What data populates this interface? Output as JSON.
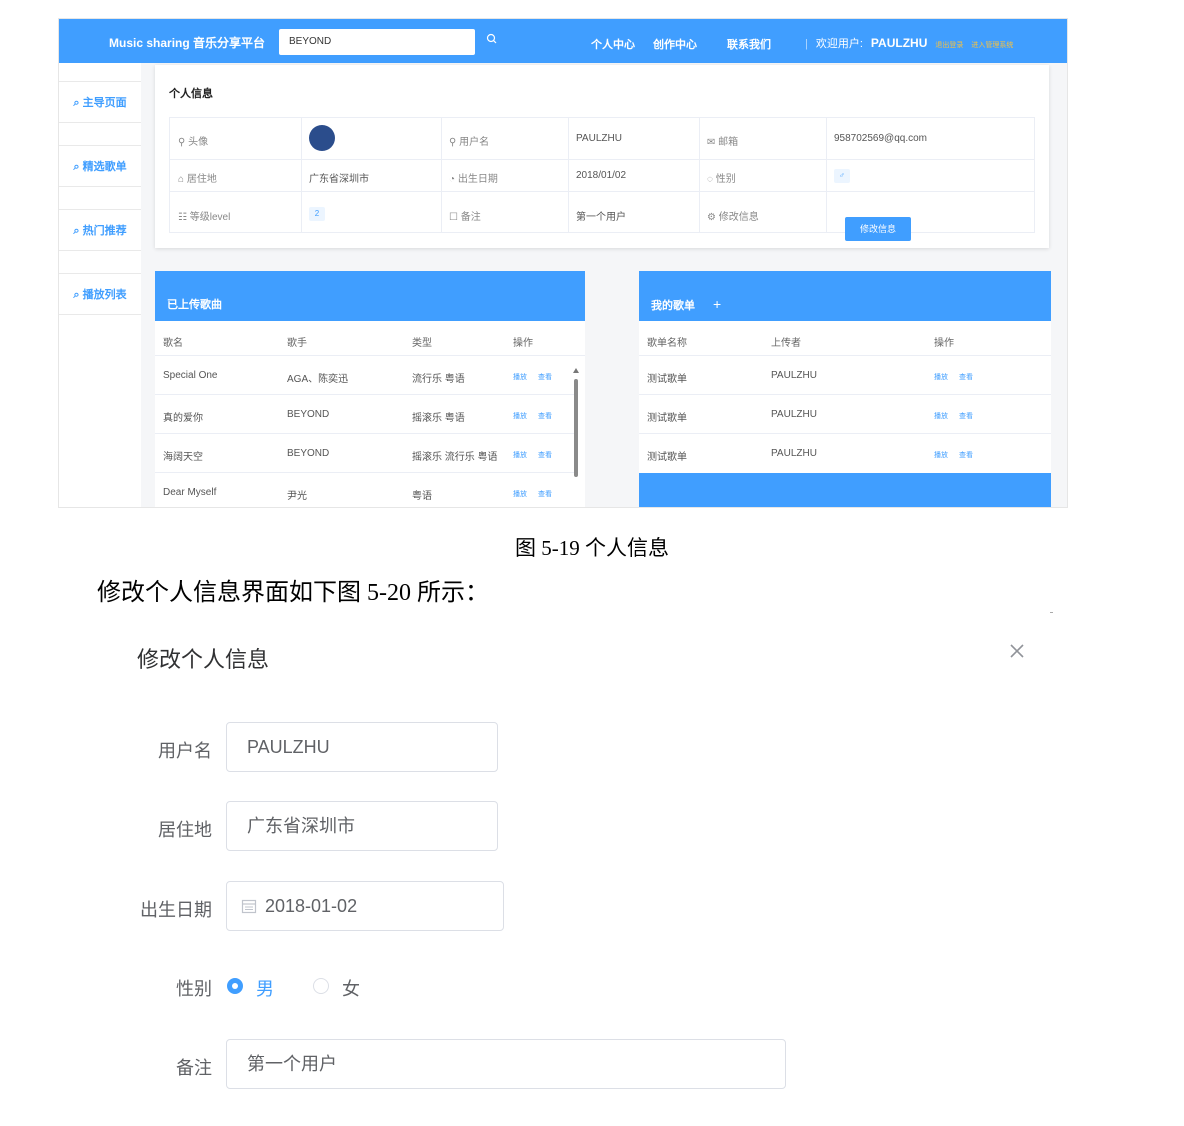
{
  "app": {
    "brand": "Music sharing 音乐分享平台",
    "search_value": "BEYOND",
    "nav": [
      "个人中心",
      "创作中心",
      "联系我们"
    ],
    "welcome_label": "欢迎用户:",
    "username": "PAULZHU",
    "tiny_links": [
      "退出登录",
      "进入管理系统"
    ]
  },
  "sidebar": {
    "items": [
      {
        "label": "主导页面"
      },
      {
        "label": "精选歌单"
      },
      {
        "label": "热门推荐"
      },
      {
        "label": "播放列表"
      }
    ]
  },
  "profile": {
    "title": "个人信息",
    "avatar_label": "头像",
    "username_label": "用户名",
    "username": "PAULZHU",
    "email_label": "邮箱",
    "email": "958702569@qq.com",
    "residence_label": "居住地",
    "residence": "广东省深圳市",
    "birthday_label": "出生日期",
    "birthday": "2018/01/02",
    "gender_label": "性别",
    "gender_symbol": "♂",
    "level_label": "等级level",
    "level": "2",
    "note_label": "备注",
    "note": "第一个用户",
    "edit_label": "修改信息",
    "edit_button": "修改信息"
  },
  "uploaded": {
    "title": "已上传歌曲",
    "headers": [
      "歌名",
      "歌手",
      "类型",
      "操作"
    ],
    "rows": [
      {
        "name": "Special One",
        "singer": "AGA、陈奕迅",
        "type": "流行乐 粤语"
      },
      {
        "name": "真的爱你",
        "singer": "BEYOND",
        "type": "摇滚乐 粤语"
      },
      {
        "name": "海阔天空",
        "singer": "BEYOND",
        "type": "摇滚乐 流行乐 粤语"
      },
      {
        "name": "Dear Myself",
        "singer": "尹光",
        "type": "粤语"
      }
    ],
    "play": "播放",
    "view": "查看"
  },
  "playlists": {
    "title": "我的歌单",
    "add": "+",
    "headers": [
      "歌单名称",
      "上传者",
      "操作"
    ],
    "rows": [
      {
        "name": "测试歌单",
        "uploader": "PAULZHU"
      },
      {
        "name": "测试歌单",
        "uploader": "PAULZHU"
      },
      {
        "name": "测试歌单",
        "uploader": "PAULZHU"
      }
    ],
    "play": "播放",
    "view": "查看"
  },
  "doc": {
    "caption": "图 5-19  个人信息",
    "paragraph": "修改个人信息界面如下图 5-20 所示："
  },
  "dialog": {
    "title": "修改个人信息",
    "username_label": "用户名",
    "username": "PAULZHU",
    "residence_label": "居住地",
    "residence": "广东省深圳市",
    "birthday_label": "出生日期",
    "birthday": "2018-01-02",
    "gender_label": "性别",
    "male": "男",
    "female": "女",
    "note_label": "备注",
    "note": "第一个用户"
  },
  "colors": {
    "primary": "#409eff"
  }
}
